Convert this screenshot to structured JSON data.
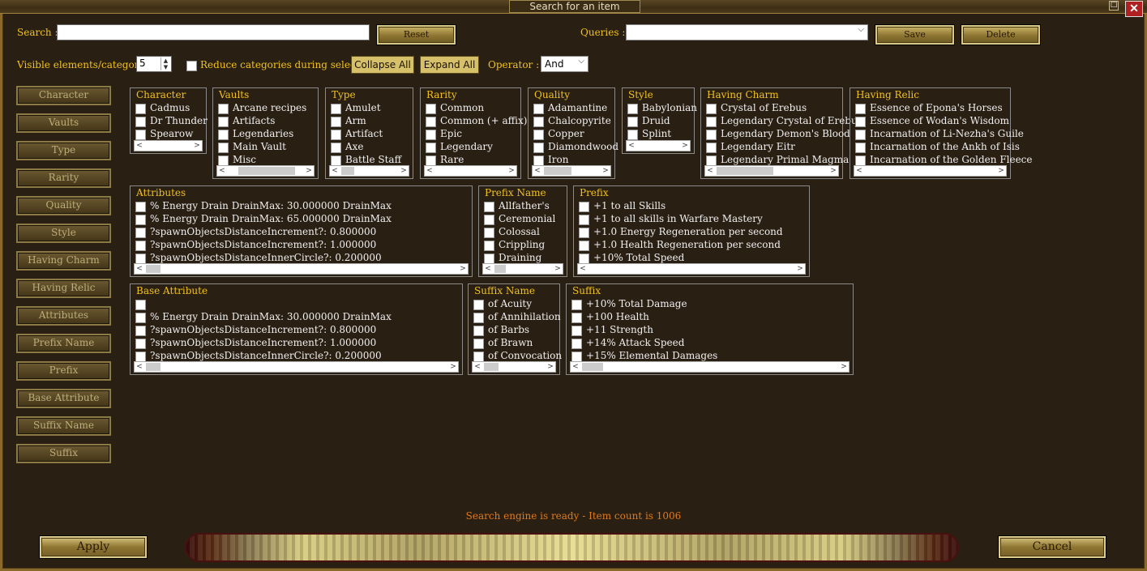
{
  "window": {
    "title": "Search for an item",
    "close_glyph": "✕",
    "min_glyph": "□"
  },
  "toolbar": {
    "search_label": "Search :",
    "search_value": "",
    "reset_label": "Reset",
    "queries_label": "Queries :",
    "queries_value": "",
    "save_label": "Save",
    "delete_label": "Delete",
    "visible_label": "Visible elements/category :",
    "visible_value": "5",
    "reduce_label": "Reduce categories during selection",
    "collapse_label": "Collapse All",
    "expand_label": "Expand All",
    "operator_label": "Operator :",
    "operator_value": "And"
  },
  "sidebar": {
    "items": [
      {
        "label": "Character"
      },
      {
        "label": "Vaults"
      },
      {
        "label": "Type"
      },
      {
        "label": "Rarity"
      },
      {
        "label": "Quality"
      },
      {
        "label": "Style"
      },
      {
        "label": "Having Charm"
      },
      {
        "label": "Having Relic"
      },
      {
        "label": "Attributes"
      },
      {
        "label": "Prefix Name"
      },
      {
        "label": "Prefix"
      },
      {
        "label": "Base Attribute"
      },
      {
        "label": "Suffix Name"
      },
      {
        "label": "Suffix"
      }
    ]
  },
  "panels": {
    "character": {
      "title": "Character",
      "items": [
        "Cadmus",
        "Dr Thunder",
        "Spearow"
      ]
    },
    "vaults": {
      "title": "Vaults",
      "items": [
        "Arcane recipes",
        "Artifacts",
        "Legendaries",
        "Main Vault",
        "Misc"
      ]
    },
    "type": {
      "title": "Type",
      "items": [
        "Amulet",
        "Arm",
        "Artifact",
        "Axe",
        "Battle Staff"
      ]
    },
    "rarity": {
      "title": "Rarity",
      "items": [
        "Common",
        "Common (+ affix)",
        "Epic",
        "Legendary",
        "Rare"
      ]
    },
    "quality": {
      "title": "Quality",
      "items": [
        "Adamantine",
        "Chalcopyrite",
        "Copper",
        "Diamondwood",
        "Iron"
      ]
    },
    "style": {
      "title": "Style",
      "items": [
        "Babylonian",
        "Druid",
        "Splint"
      ]
    },
    "having_charm": {
      "title": "Having Charm",
      "items": [
        "Crystal of Erebus",
        "Legendary Crystal of Erebus",
        "Legendary Demon's Blood",
        "Legendary Eitr",
        "Legendary Primal Magma"
      ]
    },
    "having_relic": {
      "title": "Having Relic",
      "items": [
        "Essence of Epona's Horses",
        "Essence of Wodan's Wisdom",
        "Incarnation of Li-Nezha's Guile",
        "Incarnation of the Ankh of Isis",
        "Incarnation of the Golden Fleece"
      ]
    },
    "attributes": {
      "title": "Attributes",
      "items": [
        "% Energy Drain DrainMax: 30.000000 DrainMax",
        "% Energy Drain DrainMax: 65.000000 DrainMax",
        "?spawnObjectsDistanceIncrement?: 0.800000",
        "?spawnObjectsDistanceIncrement?: 1.000000",
        "?spawnObjectsDistanceInnerCircle?: 0.200000"
      ]
    },
    "prefix_name": {
      "title": "Prefix Name",
      "items": [
        "Allfather's",
        "Ceremonial",
        "Colossal",
        "Crippling",
        "Draining"
      ]
    },
    "prefix": {
      "title": "Prefix",
      "items": [
        "+1 to all Skills",
        "+1 to all skills in Warfare Mastery",
        "+1.0 Energy Regeneration per second",
        "+1.0 Health Regeneration per second",
        "+10% Total Speed"
      ]
    },
    "base_attribute": {
      "title": "Base Attribute",
      "items": [
        "",
        "% Energy Drain DrainMax: 30.000000 DrainMax",
        "?spawnObjectsDistanceIncrement?: 0.800000",
        "?spawnObjectsDistanceIncrement?: 1.000000",
        "?spawnObjectsDistanceInnerCircle?: 0.200000"
      ]
    },
    "suffix_name": {
      "title": "Suffix Name",
      "items": [
        "of Acuity",
        "of Annihilation",
        "of Barbs",
        "of Brawn",
        "of Convocation"
      ]
    },
    "suffix": {
      "title": "Suffix",
      "items": [
        "+10% Total Damage",
        "+100 Health",
        "+11 Strength",
        "+14% Attack Speed",
        "+15% Elemental Damages"
      ]
    }
  },
  "status": "Search engine is ready - Item count is 1006",
  "footer": {
    "apply_label": "Apply",
    "cancel_label": "Cancel"
  },
  "scroll": {
    "left": "<",
    "right": ">"
  }
}
